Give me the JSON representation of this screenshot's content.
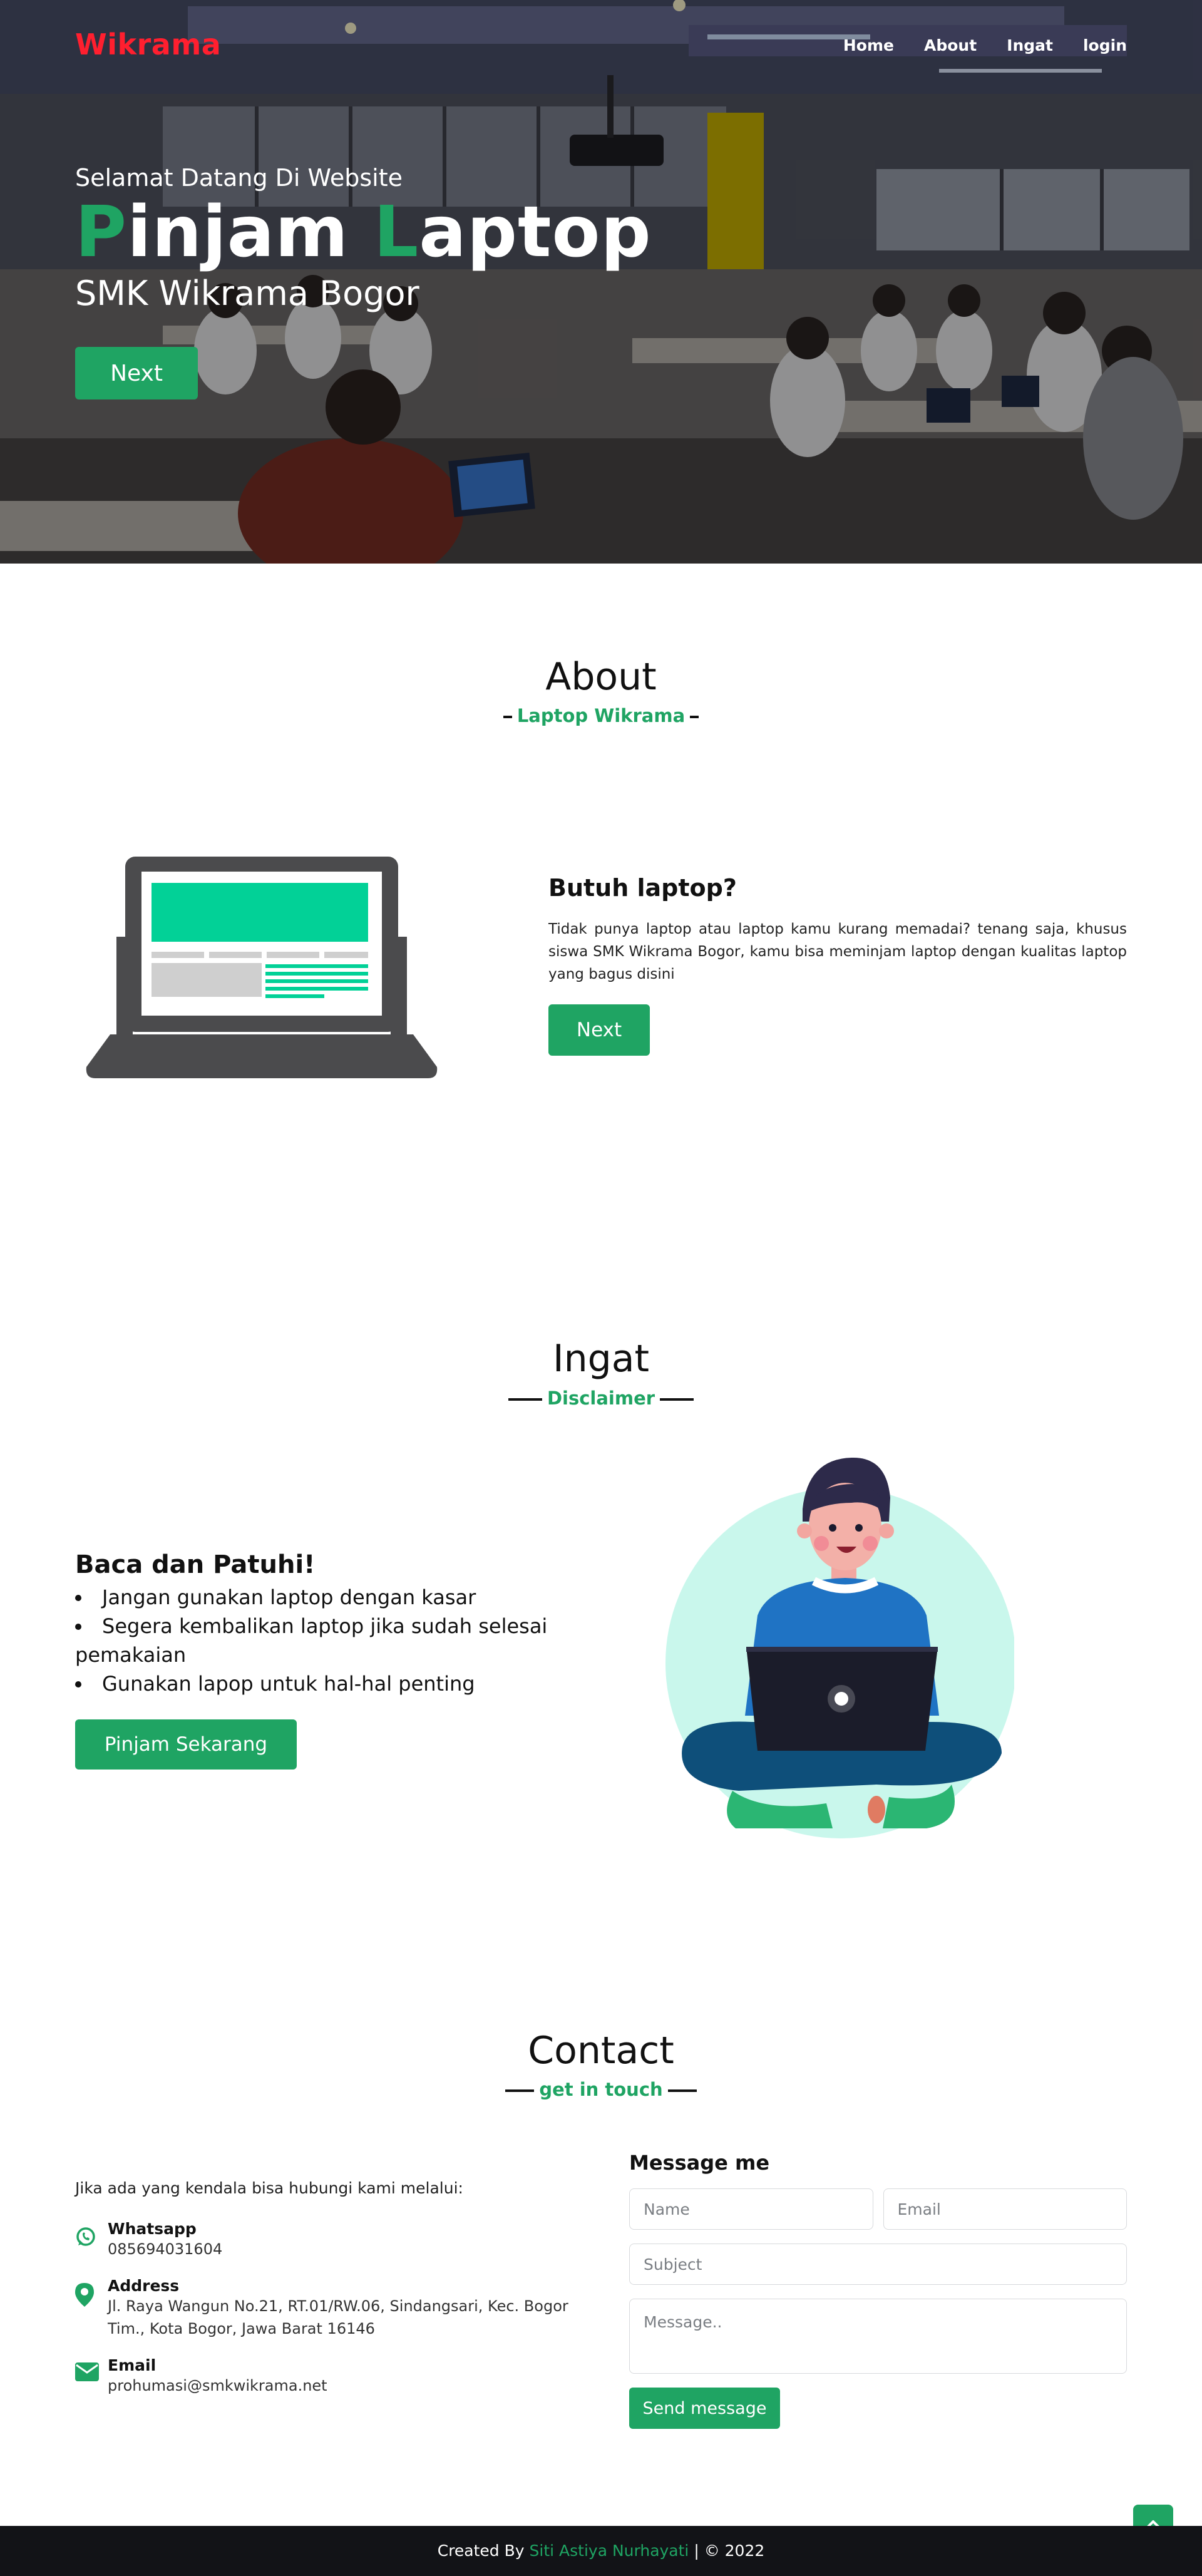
{
  "brand": "Wikrama",
  "nav": {
    "home": "Home",
    "about": "About",
    "ingat": "Ingat",
    "login": "login"
  },
  "hero": {
    "kicker": "Selamat Datang Di Website",
    "title_word1_first": "P",
    "title_word1_rest": "injam ",
    "title_word2_first": "L",
    "title_word2_rest": "aptop",
    "subtitle": "SMK Wikrama Bogor",
    "next_button": "Next"
  },
  "about": {
    "title": "About",
    "subtitle": "Laptop Wikrama",
    "card_title": "Butuh laptop?",
    "card_text": "Tidak punya laptop atau laptop kamu kurang memadai? tenang saja, khusus siswa SMK Wikrama Bogor, kamu bisa meminjam laptop dengan kualitas laptop yang bagus disini",
    "next_button": "Next"
  },
  "ingat": {
    "title": "Ingat",
    "subtitle": "Disclaimer",
    "box_title": "Baca dan Patuhi!",
    "rules": [
      "Jangan gunakan laptop dengan kasar",
      "Segera kembalikan laptop jika sudah selesai pemakaian",
      "Gunakan lapop untuk hal-hal penting"
    ],
    "button": "Pinjam Sekarang"
  },
  "contact": {
    "title": "Contact",
    "subtitle": "get in touch",
    "lead": "Jika ada yang kendala bisa hubungi kami melalui:",
    "whatsapp_label": "Whatsapp",
    "whatsapp_value": "085694031604",
    "address_label": "Address",
    "address_value": "Jl. Raya Wangun No.21, RT.01/RW.06, Sindangsari, Kec. Bogor Tim., Kota Bogor, Jawa Barat 16146",
    "email_label": "Email",
    "email_value": "prohumasi@smkwikrama.net",
    "form_title": "Message me",
    "name_placeholder": "Name",
    "email_placeholder": "Email",
    "subject_placeholder": "Subject",
    "message_placeholder": "Message..",
    "send_button": "Send message"
  },
  "footer": {
    "created_by": "Created By ",
    "author": "Siti Astiya Nurhayati",
    "suffix": " | © 2022"
  },
  "colors": {
    "accent": "#1fa463",
    "brand_red": "#ff1f2f",
    "footer_bg": "#121317"
  },
  "icons": [
    "whatsapp-icon",
    "map-pin-icon",
    "envelope-icon",
    "chevron-up-icon"
  ]
}
